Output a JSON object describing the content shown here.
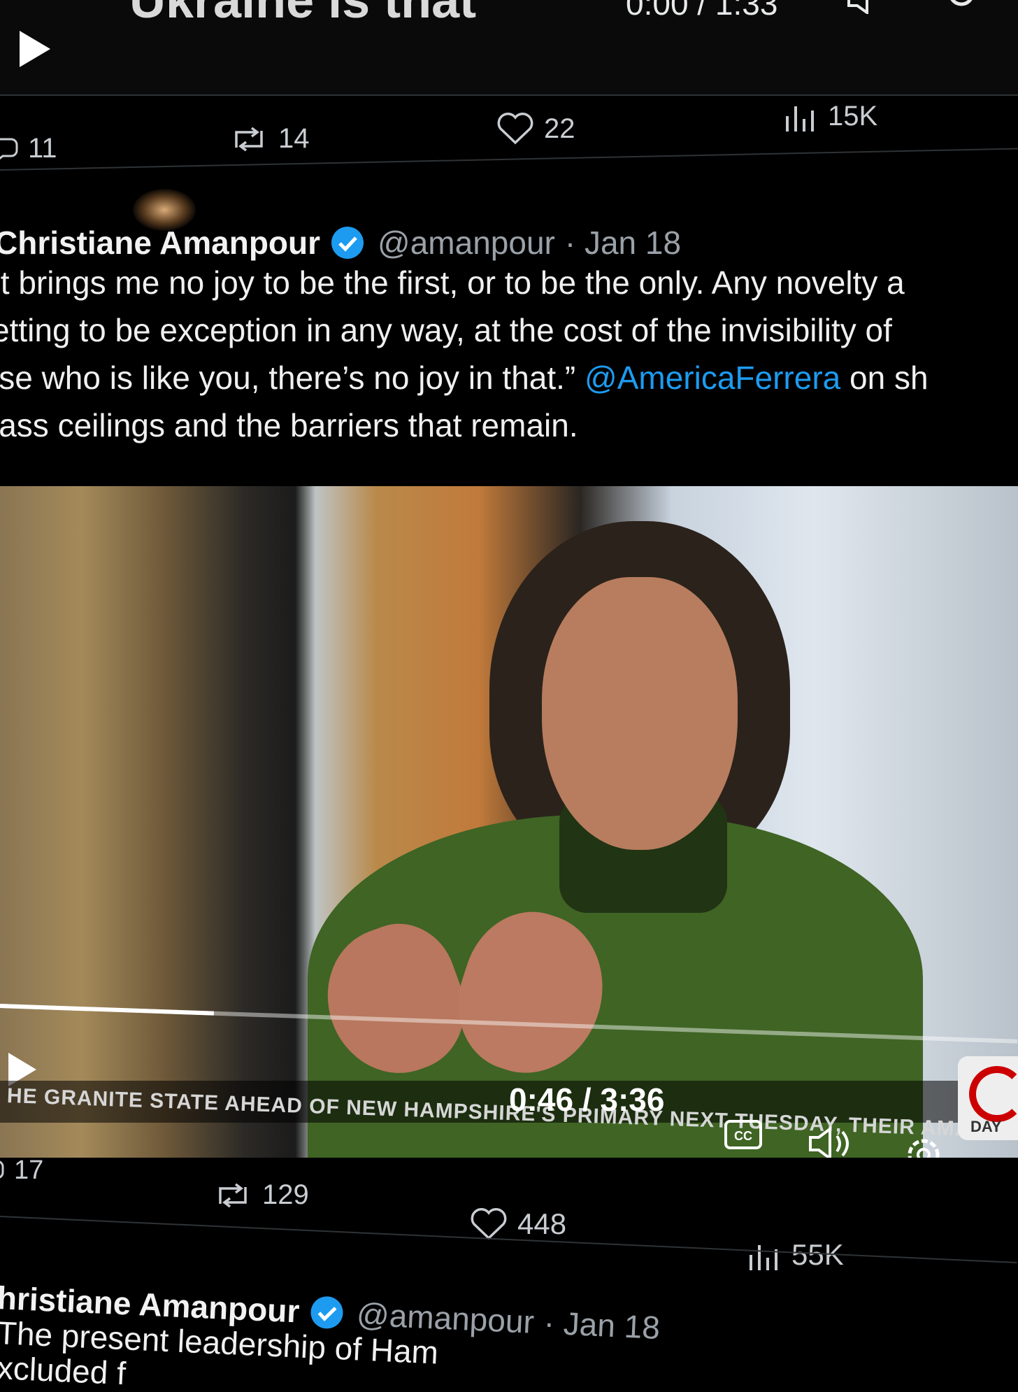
{
  "top_video": {
    "title_fragment": "Ukraine is that",
    "time": "0:00 / 1:33"
  },
  "tweet1_actions": {
    "replies": "11",
    "reposts": "14",
    "likes": "22",
    "views": "15K"
  },
  "tweet2": {
    "author": "Christiane Amanpour",
    "handle": "@amanpour",
    "date": "· Jan 18",
    "text_line1": "It brings me no joy to be the first, or to be the only. Any novelty a",
    "text_line2": "etting to be exception in any way, at the cost of the invisibility of",
    "text_line3_pre": "lse who is like you, there’s no joy in that.”",
    "text_line3_mention": "@AmericaFerrera",
    "text_line3_post": "on sh",
    "text_line4": "lass ceilings and the barriers that remain.",
    "video": {
      "caption": "HE GRANITE STATE AHEAD OF NEW HAMPSHIRE'S PRIMARY NEXT TUESDAY, THEIR AMA",
      "time": "0:46 / 3:36",
      "progress": 0.21,
      "logo_label": "DAY"
    },
    "actions": {
      "replies": "17",
      "reposts": "129",
      "likes": "448",
      "views": "55K"
    }
  },
  "tweet3": {
    "author": "hristiane Amanpour",
    "handle": "@amanpour",
    "date": "· Jan 18",
    "text_line1": "The present leadership of Ham",
    "text_line2": "xcluded f"
  },
  "colors": {
    "background": "#000000",
    "mention": "#1d9bf0",
    "verified": "#1d9bf0"
  }
}
